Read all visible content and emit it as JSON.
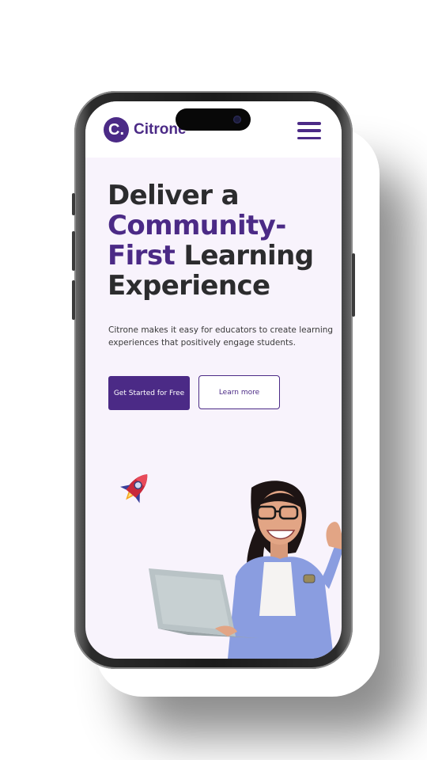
{
  "brand": {
    "logo_letter": "C.",
    "name": "Citrone",
    "color": "#4b2a86"
  },
  "hero": {
    "title_line1": "Deliver a",
    "title_accent": "Community-First",
    "title_accent_part1": "Community-",
    "title_accent_part2": "First",
    "title_rest": "Learning",
    "title_line4": "Experience",
    "description": "Citrone makes it easy for educators to create learning experiences that positively engage students."
  },
  "buttons": {
    "primary_label": "Get Started for Free",
    "secondary_label": "Learn more"
  },
  "icons": {
    "menu": "hamburger-menu-icon",
    "rocket": "rocket-icon"
  },
  "colors": {
    "background": "#f8f3fc",
    "accent": "#4b2a86",
    "text": "#2c2c2e"
  }
}
